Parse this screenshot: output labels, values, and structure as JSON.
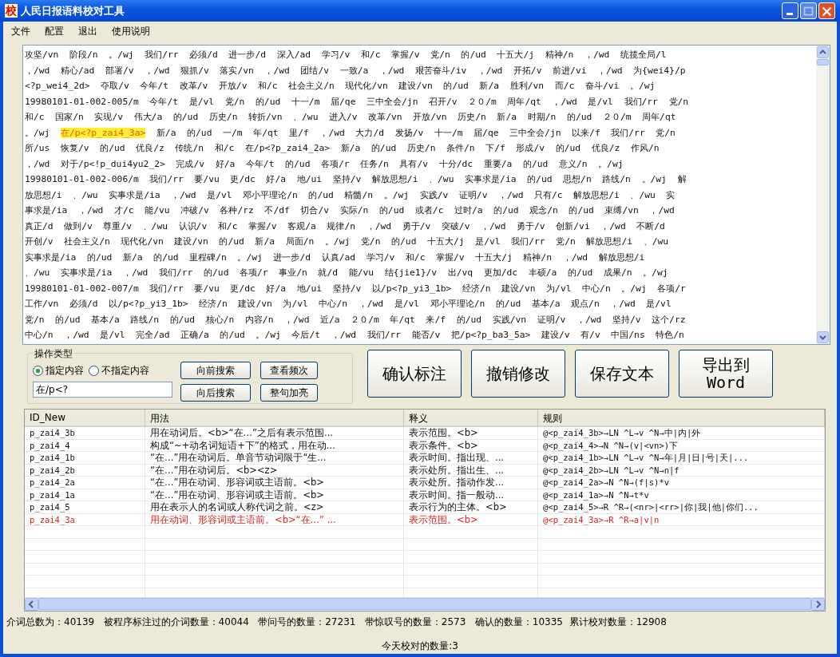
{
  "window": {
    "title": "人民日报语料校对工具",
    "icon_text": "校"
  },
  "menu": [
    "文件",
    "配置",
    "退出",
    "使用说明"
  ],
  "text_area": {
    "lines": [
      {
        "text": "攻坚/vn  阶段/n  。/wj  我们/rr  必须/d  进一步/d  深入/ad  学习/v  和/c  掌握/v  党/n  的/ud  十五大/j  精神/n  ，/wd  统揽全局/l"
      },
      {
        "text": "，/wd  精心/ad  部署/v  ，/wd  狠抓/v  落实/vn  ，/wd  团结/v  一致/a  ，/wd  艰苦奋斗/iv  ，/wd  开拓/v  前进/vi  ，/wd  为{wei4}/p"
      },
      {
        "text": "<?p_wei4_2d>  夺取/v  今年/t  改革/v  开放/v  和/c  社会主义/n  现代化/vn  建设/vn  的/ud  新/a  胜利/vn  而/c  奋斗/vi  。/wj"
      },
      {
        "text": "19980101-01-002-005/m  今年/t  是/vl  党/n  的/ud  十一/m  届/qe  三中全会/jn  召开/v  ２０/m  周年/qt  ，/wd  是/vl  我们/rr  党/n"
      },
      {
        "text": "和/c  国家/n  实现/v  伟大/a  的/ud  历史/n  转折/vn  、/wu  进入/v  改革/vn  开放/vn  历史/n  新/a  时期/n  的/ud  ２０/m  周年/qt"
      },
      {
        "text": "。/wj  ",
        "mark": "在/p<?p_zai4_3a>",
        "rest": "  新/a  的/ud  一/m  年/qt  里/f  ，/wd  大力/d  发扬/v  十一/m  届/qe  三中全会/jn  以来/f  我们/rr  党/n"
      },
      {
        "text": "所/us  恢复/v  的/ud  优良/z  传统/n  和/c  在/p<?p_zai4_2a>  新/a  的/ud  历史/n  条件/n  下/f  形成/v  的/ud  优良/z  作风/n"
      },
      {
        "text": "，/wd  对于/p<!p_dui4yu2_2>  完成/v  好/a  今年/t  的/ud  各项/r  任务/n  具有/v  十分/dc  重要/a  的/ud  意义/n  。/wj"
      },
      {
        "text": "19980101-01-002-006/m  我们/rr  要/vu  更/dc  好/a  地/ui  坚持/v  解放思想/i  、/wu  实事求是/ia  的/ud  思想/n  路线/n  。/wj  解"
      },
      {
        "text": "放思想/i  、/wu  实事求是/ia  ，/wd  是/vl  邓小平理论/n  的/ud  精髓/n  。/wj  实践/v  证明/v  ，/wd  只有/c  解放思想/i  、/wu  实"
      },
      {
        "text": "事求是/ia  ，/wd  才/c  能/vu  冲破/v  各种/rz  不/df  切合/v  实际/n  的/ud  或者/c  过时/a  的/ud  观念/n  的/ud  束缚/vn  ，/wd"
      },
      {
        "text": "真正/d  做到/v  尊重/v  、/wu  认识/v  和/c  掌握/v  客观/a  规律/n  ，/wd  勇于/v  突破/v  ，/wd  勇于/v  创新/vi  ，/wd  不断/d"
      },
      {
        "text": "开创/v  社会主义/n  现代化/vn  建设/vn  的/ud  新/a  局面/n  。/wj  党/n  的/ud  十五大/j  是/vl  我们/rr  党/n  解放思想/i  、/wu"
      },
      {
        "text": "实事求是/ia  的/ud  新/a  的/ud  里程碑/n  。/wj  进一步/d  认真/ad  学习/v  和/c  掌握/v  十五大/j  精神/n  ，/wd  解放思想/i"
      },
      {
        "text": "、/wu  实事求是/ia  ，/wd  我们/rr  的/ud  各项/r  事业/n  就/d  能/vu  结{jie1}/v  出/vq  更加/dc  丰硕/a  的/ud  成果/n  。/wj"
      },
      {
        "text": "19980101-01-002-007/m  我们/rr  要/vu  更/dc  好/a  地/ui  坚持/v  以/p<?p_yi3_1b>  经济/n  建设/vn  为/vl  中心/n  。/wj  各项/r"
      },
      {
        "text": "工作/vn  必须/d  以/p<?p_yi3_1b>  经济/n  建设/vn  为/vl  中心/n  ，/wd  是/vl  邓小平理论/n  的/ud  基本/a  观点/n  ，/wd  是/vl"
      },
      {
        "text": "党/n  的/ud  基本/a  路线/n  的/ud  核心/n  内容/n  ，/wd  近/a  ２０/m  年/qt  来/f  的/ud  实践/vn  证明/v  ，/wd  坚持/v  这个/rz"
      },
      {
        "text": "中心/n  ，/wd  是/vl  完全/ad  正确/a  的/ud  。/wj  今后/t  ，/wd  我们/rr  能否/v  把/p<?p_ba3_5a>  建设/v  有/v  中国/ns  特色/n"
      }
    ]
  },
  "operation": {
    "title": "操作类型",
    "radios": [
      {
        "label": "指定内容",
        "selected": true
      },
      {
        "label": "不指定内容",
        "selected": false
      }
    ],
    "search_value": "在/p<?",
    "buttons": [
      "向前搜索",
      "查看频次",
      "向后搜索",
      "整句加亮"
    ]
  },
  "actions": [
    {
      "label": "确认标注"
    },
    {
      "label": "撤销修改"
    },
    {
      "label": "保存文本"
    },
    {
      "label": "导出到",
      "label_2": "Word"
    }
  ],
  "table": {
    "columns": [
      "ID_New",
      "用法",
      "释义",
      "规则"
    ],
    "rows": [
      {
        "cells": [
          "p_zai4_3b",
          "用在动词后。<b>“在…”之后有表示范围...",
          "表示范围。<b>",
          "@<p_zai4_3b>→LN ^L→v ^N→中|内|外"
        ],
        "selected": false
      },
      {
        "cells": [
          "p_zai4_4",
          "构成“~+动名词短语+下”的格式，用在动...",
          "表示条件。<b>",
          "@<p_zai4_4>→N ^N→(v|<vn>)下"
        ],
        "selected": false
      },
      {
        "cells": [
          "p_zai4_1b",
          "“在…”用在动词后。单音节动词限于“生...",
          "表示时间。指出现、...",
          "@<p_zai4_1b>→LN ^L→v ^N→年|月|日|号|天|..."
        ],
        "selected": false
      },
      {
        "cells": [
          "p_zai4_2b",
          "“在…”用在动词后。<b><z>",
          "表示处所。指出生、...",
          "@<p_zai4_2b>→LN ^L→v ^N→n|f"
        ],
        "selected": false
      },
      {
        "cells": [
          "p_zai4_2a",
          "“在…”用在动词、形容词或主语前。<b>",
          "表示处所。指动作发...",
          "@<p_zai4_2a>→N ^N→(f|s)*v"
        ],
        "selected": false
      },
      {
        "cells": [
          "p_zai4_1a",
          "“在…”用在动词、形容词或主语前。<b>",
          "表示时间。指一般动...",
          "@<p_zai4_1a>→N ^N→t*v"
        ],
        "selected": false
      },
      {
        "cells": [
          "p_zai4_5",
          "用在表示人的名词或人称代词之前。<z>",
          "表示行为的主体。<b>",
          "@<p_zai4_5>→R ^R→(<nr>|<rr>|你|我|他|你们..."
        ],
        "selected": false
      },
      {
        "cells": [
          "p_zai4_3a",
          "用在动词、形容词或主语前。<b>“在…” ...",
          "表示范围。<b>",
          "@<p_zai4_3a>→R ^R→a|v|n"
        ],
        "selected": true
      }
    ]
  },
  "status_bar": {
    "line_1": "介词总数为：40139   被程序标注过的介词数量：40044   带问号的数量：27231   带惊叹号的数量：2573   确认的数量：10335  累计校对数量：12908",
    "line_2": "今天校对的数量:3"
  }
}
